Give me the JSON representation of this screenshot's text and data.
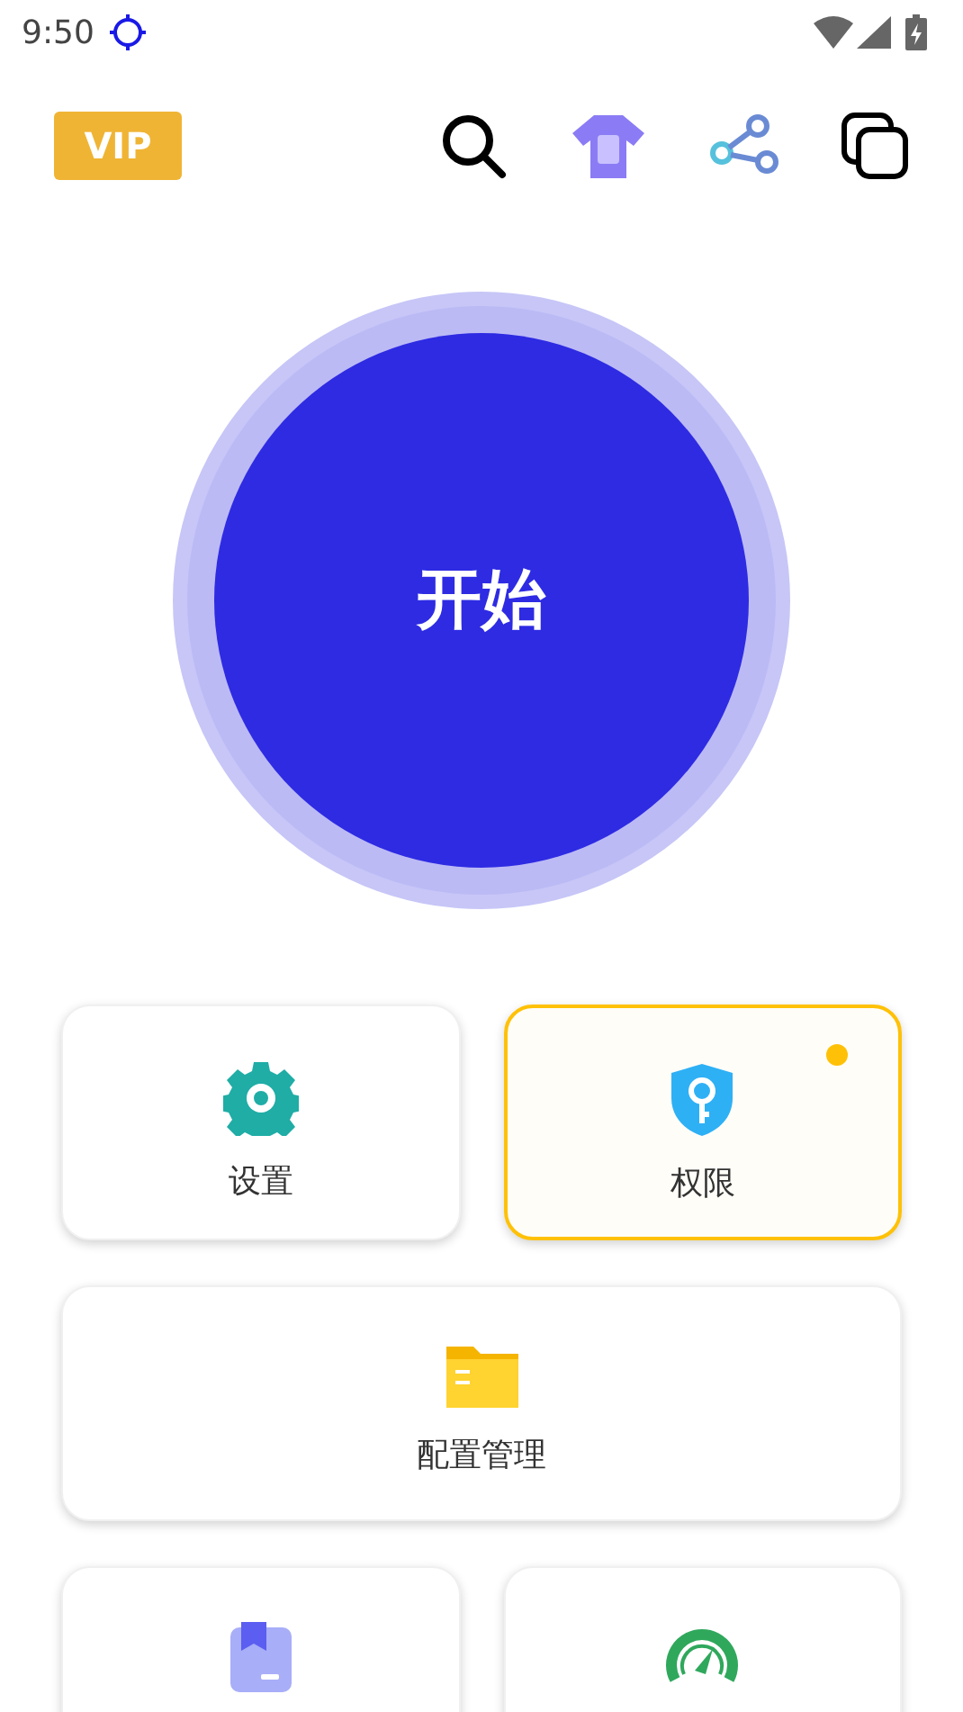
{
  "status_bar": {
    "time": "9:50"
  },
  "header": {
    "vip_badge": "VIP"
  },
  "start_button": {
    "label": "开始"
  },
  "tiles": [
    {
      "label": "设置",
      "highlighted": false,
      "dot": false
    },
    {
      "label": "权限",
      "highlighted": true,
      "dot": true
    },
    {
      "label": "配置管理",
      "highlighted": false,
      "dot": false
    },
    {
      "highlighted": false,
      "dot": false
    },
    {
      "highlighted": false,
      "dot": false
    }
  ]
}
